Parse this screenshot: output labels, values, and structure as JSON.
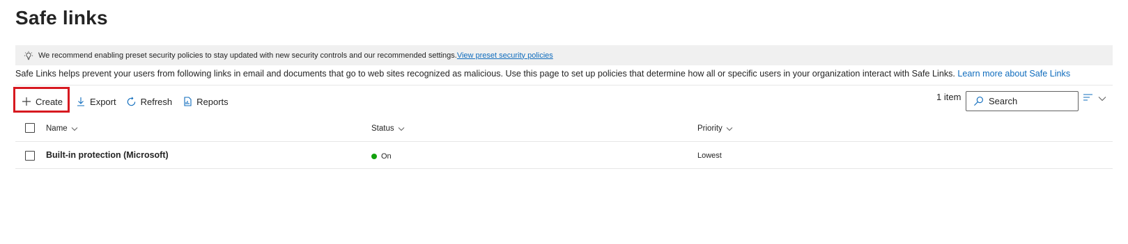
{
  "page": {
    "title": "Safe links"
  },
  "banner": {
    "icon": "lightbulb-icon",
    "text": "We recommend enabling preset security policies to stay updated with new security controls and our recommended settings.",
    "link": "View preset security policies"
  },
  "description": {
    "text": "Safe Links helps prevent your users from following links in email and documents that go to web sites recognized as malicious. Use this page to set up policies that determine how all or specific users in your organization interact with Safe Links. ",
    "link": "Learn more about Safe Links"
  },
  "toolbar": {
    "create_label": "Create",
    "export_label": "Export",
    "refresh_label": "Refresh",
    "reports_label": "Reports",
    "item_count": "1 item",
    "search_placeholder": "Search"
  },
  "table": {
    "columns": [
      "Name",
      "Status",
      "Priority"
    ],
    "rows": [
      {
        "name": "Built-in protection (Microsoft)",
        "status": "On",
        "priority": "Lowest"
      }
    ]
  },
  "colors": {
    "accent": "#0f6cbd",
    "highlight": "#d71920",
    "status_on": "#13a10e"
  }
}
